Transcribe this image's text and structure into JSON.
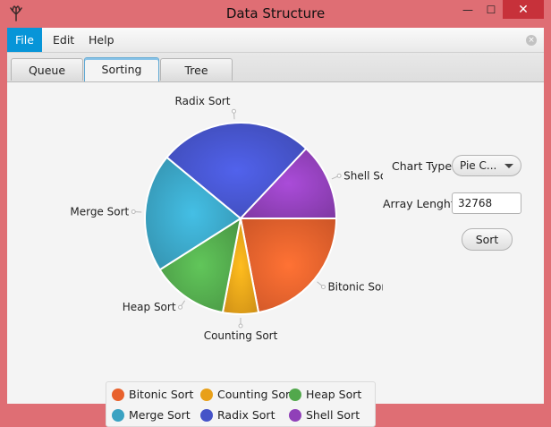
{
  "window": {
    "title": "Data Structure",
    "minimize_glyph": "—",
    "maximize_glyph": "☐",
    "close_glyph": "✕"
  },
  "menu": {
    "items": [
      "File",
      "Edit",
      "Help"
    ],
    "active_index": 0,
    "close_glyph": "×"
  },
  "tabs": {
    "items": [
      "Queue",
      "Sorting",
      "Tree"
    ],
    "active_index": 1
  },
  "controls": {
    "chart_type_label": "Chart Type",
    "chart_type_value": "Pie C...",
    "array_length_label": "Array Lenght",
    "array_length_value": "32768",
    "sort_button": "Sort"
  },
  "colors": {
    "accent": "#0795d8",
    "window_border": "#df6e74",
    "close_button": "#c7313a"
  },
  "chart_data": {
    "type": "pie",
    "categories": [
      "Bitonic Sort",
      "Counting Sort",
      "Heap Sort",
      "Merge Sort",
      "Radix Sort",
      "Shell Sort"
    ],
    "values": [
      22,
      6,
      13,
      20,
      26,
      13
    ],
    "colors": [
      "#e8612c",
      "#e8a019",
      "#52a84c",
      "#3aa2c2",
      "#4553c8",
      "#9040b8"
    ],
    "start_angle_deg": 0,
    "direction": "clockwise",
    "legend_position": "bottom",
    "title": ""
  }
}
